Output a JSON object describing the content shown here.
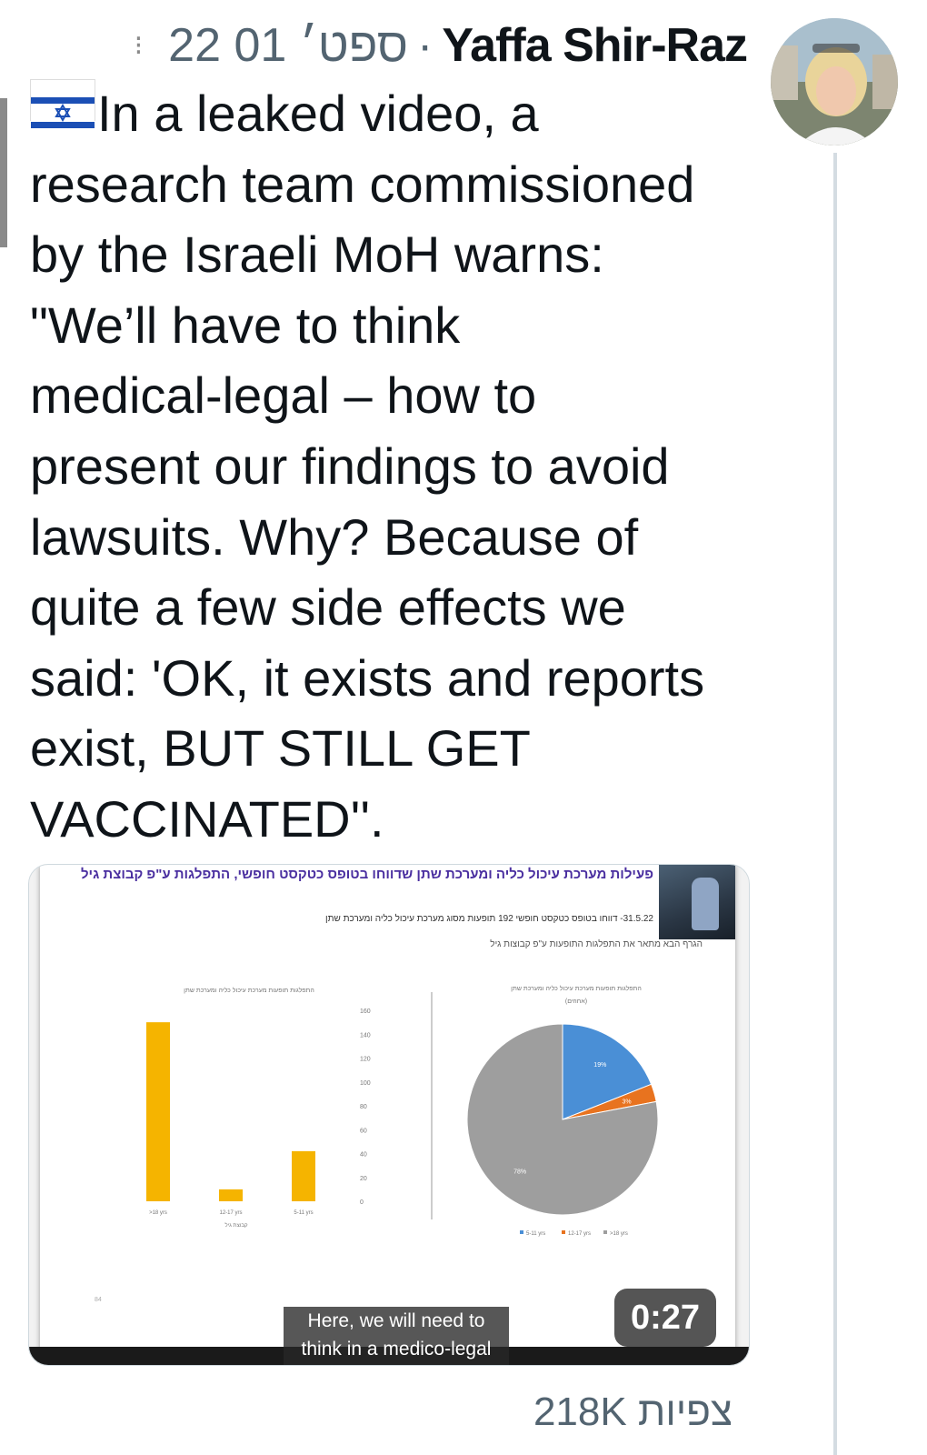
{
  "header": {
    "more_glyph": "⁝",
    "timestamp": "22 ספט׳ 01",
    "separator": "·",
    "author": "Yaffa Shir-Raz"
  },
  "tweet": {
    "flag_emoji": "🇮🇱",
    "lines": [
      "In a leaked video, a",
      "research team commissioned",
      "by the Israeli MoH warns:",
      "\"We’ll have to think",
      "medical-legal – how to",
      "present our findings to avoid",
      "lawsuits. Why? Because of",
      "quite a few side effects we",
      "said: 'OK, it exists and reports",
      "exist, BUT STILL GET",
      "VACCINATED''."
    ]
  },
  "video": {
    "duration": "0:27",
    "caption_line1": "Here, we will need to",
    "caption_line2": "think in a medico-legal way",
    "slide_title": "פעילות מערכת עיכול כליה ומערכת שתן שדווחו בטופס כטקסט חופשי, התפלגות ע\"פ קבוצת גיל",
    "slide_subtitle": "31.5.22- דווחו בטופס כטקסט חופשי 192 תופעות מסוג מערכת עיכול כליה ומערכת שתן",
    "slide_subtitle2": "הגרף הבא מתאר את התפלגות התופעות ע\"פ קבוצות גיל",
    "page_number": "84",
    "colors": {
      "bar": "#f5b400",
      "pie_gray": "#9e9e9e",
      "pie_blue": "#4a8fd6",
      "pie_orange": "#e8731f",
      "chart_text": "#777777"
    },
    "charts": [
      {
        "type": "bar",
        "title": "התפלגות תופעות מערכת עיכול כליה ומערכת שתן",
        "categories": [
          ">18 yrs",
          "12-17 yrs",
          "5-11 yrs"
        ],
        "values": [
          150,
          10,
          42
        ],
        "ylim": [
          0,
          160
        ],
        "yticks": [
          "160",
          "140",
          "120",
          "100",
          "80",
          "60",
          "40",
          "20",
          "0"
        ],
        "xlabel": "קבוצת גיל"
      },
      {
        "type": "pie",
        "title": "התפלגות תופעות מערכת עיכול כליה ומערכת שתן",
        "subtitle": "(אחוזים)",
        "slices": [
          {
            "label": "5-11 yrs",
            "value": 19,
            "text": "19%"
          },
          {
            "label": "12-17 yrs",
            "value": 3,
            "text": "3%"
          },
          {
            "label": ">18 yrs",
            "value": 78,
            "text": "78%"
          }
        ]
      }
    ]
  },
  "stats": {
    "views": "218K צפיות"
  }
}
